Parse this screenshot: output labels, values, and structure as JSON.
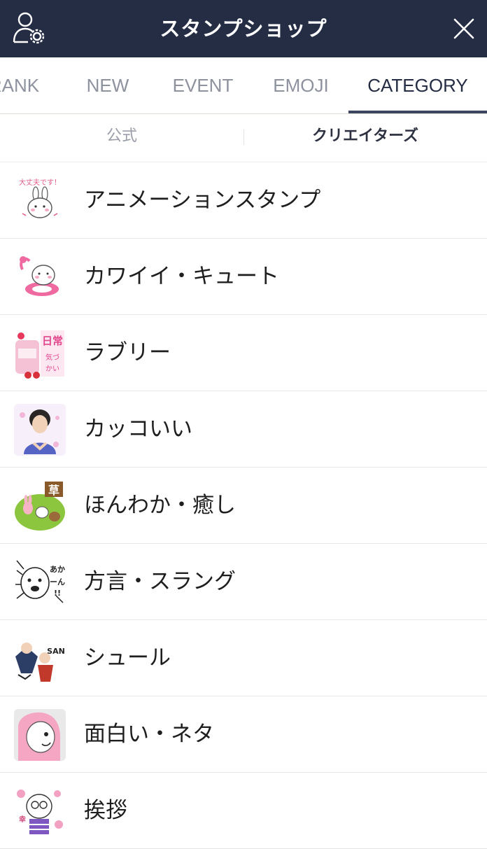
{
  "header": {
    "title": "スタンプショップ",
    "settings_icon": "user-settings-icon",
    "close_icon": "close-icon"
  },
  "tabs": [
    {
      "label": "RANK",
      "active": false
    },
    {
      "label": "NEW",
      "active": false
    },
    {
      "label": "EVENT",
      "active": false
    },
    {
      "label": "EMOJI",
      "active": false
    },
    {
      "label": "CATEGORY",
      "active": true
    }
  ],
  "subtabs": [
    {
      "label": "公式",
      "active": false
    },
    {
      "label": "クリエイターズ",
      "active": true
    }
  ],
  "categories": [
    {
      "label": "アニメーションスタンプ",
      "thumb_text": "大丈夫です！"
    },
    {
      "label": "カワイイ・キュート"
    },
    {
      "label": "ラブリー",
      "thumb_text": "日常 気づかい"
    },
    {
      "label": "カッコいい"
    },
    {
      "label": "ほんわか・癒し",
      "thumb_text": "草"
    },
    {
      "label": "方言・スラング",
      "thumb_text": "あかーん!!"
    },
    {
      "label": "シュール",
      "thumb_text": "SAN"
    },
    {
      "label": "面白い・ネタ"
    },
    {
      "label": "挨拶",
      "thumb_text": "幸あれ"
    }
  ],
  "colors": {
    "header_bg": "#252d45",
    "tab_active": "#252d45",
    "tab_inactive": "#8d929e",
    "divider": "#e6e6e6"
  }
}
